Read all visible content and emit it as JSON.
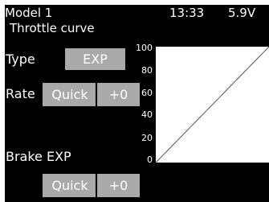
{
  "header": {
    "model_name": "Model 1",
    "clock": "13:33",
    "voltage": "5.9V"
  },
  "screen_title": "Throttle curve",
  "type": {
    "label": "Type",
    "value": "EXP"
  },
  "rate": {
    "label": "Rate",
    "mode": "Quick",
    "value": "+0"
  },
  "brake_exp": {
    "label": "Brake EXP",
    "mode": "Quick",
    "value": "+0"
  },
  "graph": {
    "y_ticks": [
      "100",
      "80",
      "60",
      "40",
      "20",
      "0"
    ],
    "curve_exp": 0
  },
  "colors": {
    "background": "#000000",
    "button": "#a9a9a9",
    "graph_background": "#ffffff",
    "curve": "#555555"
  }
}
